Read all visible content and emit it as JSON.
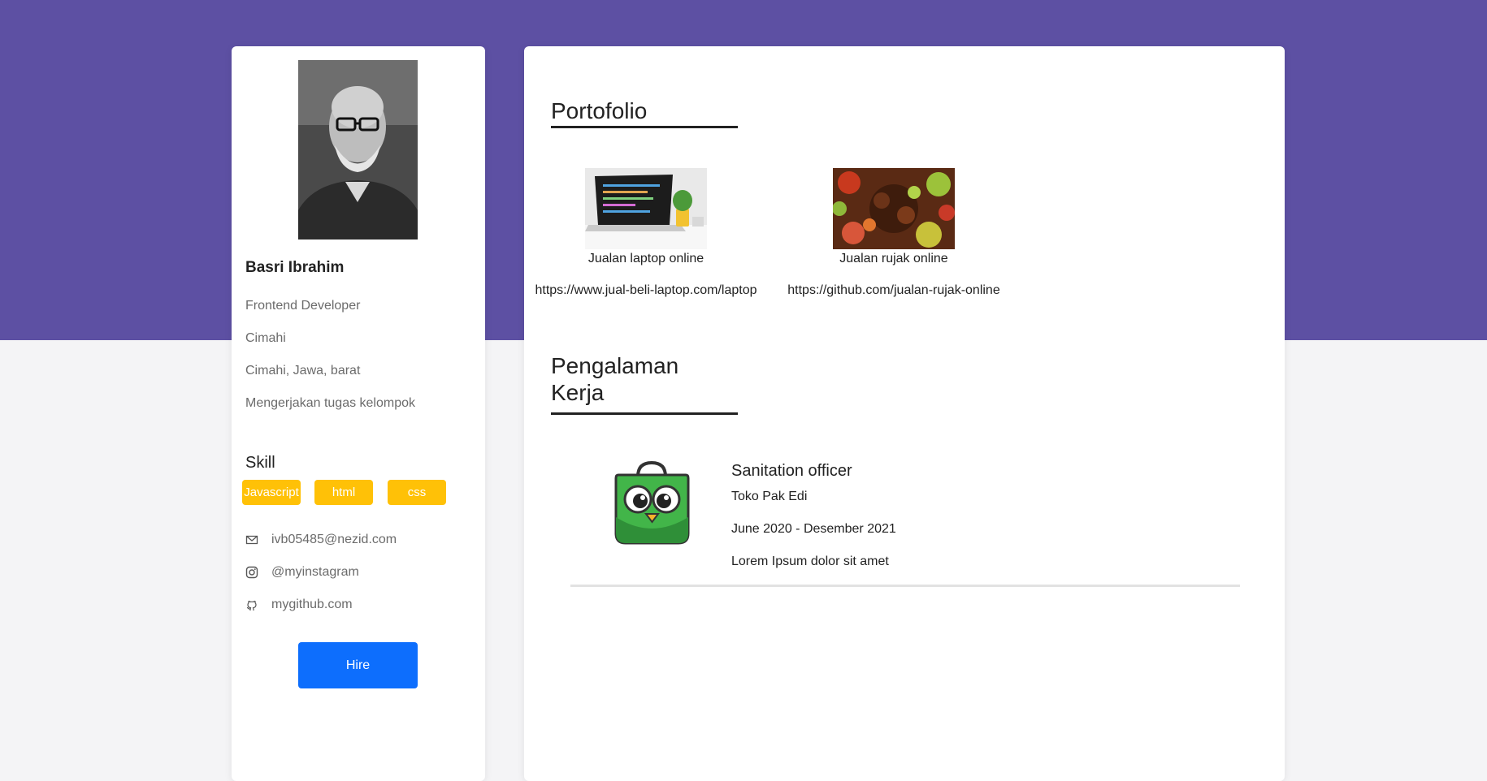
{
  "profile": {
    "name": "Basri Ibrahim",
    "details": [
      "Frontend Developer",
      "Cimahi",
      "Cimahi, Jawa, barat",
      "Mengerjakan tugas kelompok"
    ],
    "skill_title": "Skill",
    "skills": [
      "Javascript",
      "html",
      "css"
    ],
    "contacts": [
      {
        "icon": "mail-icon",
        "text": "ivb05485@nezid.com"
      },
      {
        "icon": "instagram-icon",
        "text": "@myinstagram"
      },
      {
        "icon": "github-icon",
        "text": "mygithub.com"
      }
    ],
    "hire_label": "Hire"
  },
  "portfolio": {
    "title": "Portofolio",
    "items": [
      {
        "title": "Jualan laptop online",
        "link": "https://www.jual-beli-laptop.com/laptop"
      },
      {
        "title": "Jualan rujak online",
        "link": "https://github.com/jualan-rujak-online"
      }
    ]
  },
  "experience": {
    "title": "Pengalaman Kerja",
    "jobs": [
      {
        "position": "Sanitation officer",
        "company": "Toko Pak Edi",
        "period": "June 2020 - Desember 2021",
        "description": "Lorem Ipsum dolor sit amet"
      }
    ]
  },
  "colors": {
    "banner": "#5d50a3",
    "skill_badge": "#ffc107",
    "hire_button": "#0d6efd",
    "background": "#f4f4f6"
  }
}
